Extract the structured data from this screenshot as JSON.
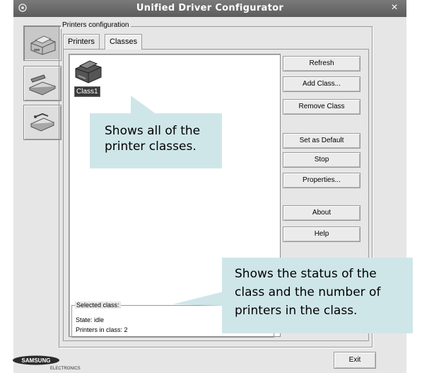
{
  "window": {
    "title": "Unified Driver Configurator",
    "close_glyph": "×"
  },
  "sidebar": {
    "items": [
      {
        "icon": "printer-icon",
        "active": true
      },
      {
        "icon": "scanner-icon",
        "active": false
      },
      {
        "icon": "ports-icon",
        "active": false
      }
    ]
  },
  "printers_config": {
    "group_label": "Printers configuration",
    "tabs": [
      {
        "label": "Printers",
        "selected": false
      },
      {
        "label": "Classes",
        "selected": true
      }
    ],
    "classes": [
      {
        "label": "Class1",
        "icon": "printer-class-icon",
        "selected": true
      }
    ]
  },
  "buttons": {
    "refresh": "Refresh",
    "add_class": "Add Class...",
    "remove_class": "Remove Class",
    "set_default": "Set as Default",
    "stop": "Stop",
    "properties": "Properties...",
    "about": "About",
    "help": "Help",
    "exit": "Exit"
  },
  "selected_class": {
    "title": "Selected class:",
    "state": "State: idle",
    "printers_in_class": "Printers in class: 2"
  },
  "callouts": {
    "classes_line1": "Shows all of the",
    "classes_line2": "printer classes.",
    "status_line1": "Shows the status of the",
    "status_line2": "class and the number of",
    "status_line3": "printers in the class."
  },
  "brand": {
    "line1": "SAMSUNG",
    "line2": "ELECTRONICS"
  },
  "colors": {
    "callout_bg": "#cfe6e9",
    "titlebar": "#6b6b6b"
  }
}
